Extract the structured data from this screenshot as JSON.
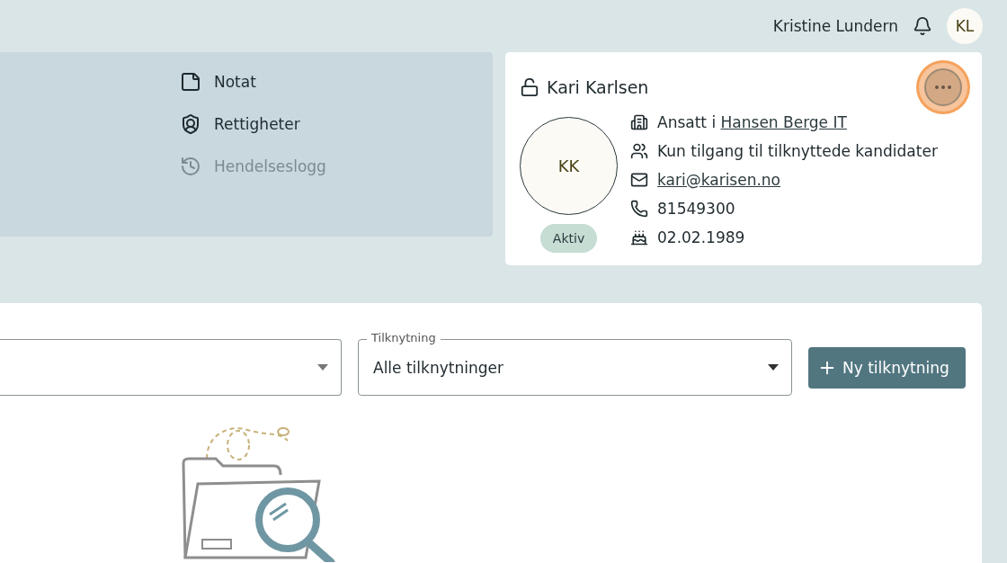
{
  "header": {
    "user_name": "Kristine Lundern",
    "avatar_initials": "KL"
  },
  "menu": [
    {
      "label": "Notat",
      "kind": "note",
      "disabled": false
    },
    {
      "label": "Rettigheter",
      "kind": "permissions",
      "disabled": false
    },
    {
      "label": "Hendelseslogg",
      "kind": "log",
      "disabled": true
    }
  ],
  "profile": {
    "name": "Kari Karlsen",
    "initials": "KK",
    "status": "Aktiv",
    "more_button_focused": true,
    "details": [
      {
        "kind": "employer",
        "prefix": "Ansatt i ",
        "link": "Hansen Berge IT"
      },
      {
        "kind": "access",
        "text": "Kun tilgang til tilknyttede kandidater"
      },
      {
        "kind": "email",
        "link": "kari@karisen.no"
      },
      {
        "kind": "phone",
        "text": "81549300"
      },
      {
        "kind": "birthday",
        "text": "02.02.1989"
      }
    ]
  },
  "filters": [
    {
      "kind": "select"
    },
    {
      "kind": "select",
      "label": "Tilknytning",
      "value": "Alle tilknytninger"
    }
  ],
  "new_button": "Ny tilknytning"
}
